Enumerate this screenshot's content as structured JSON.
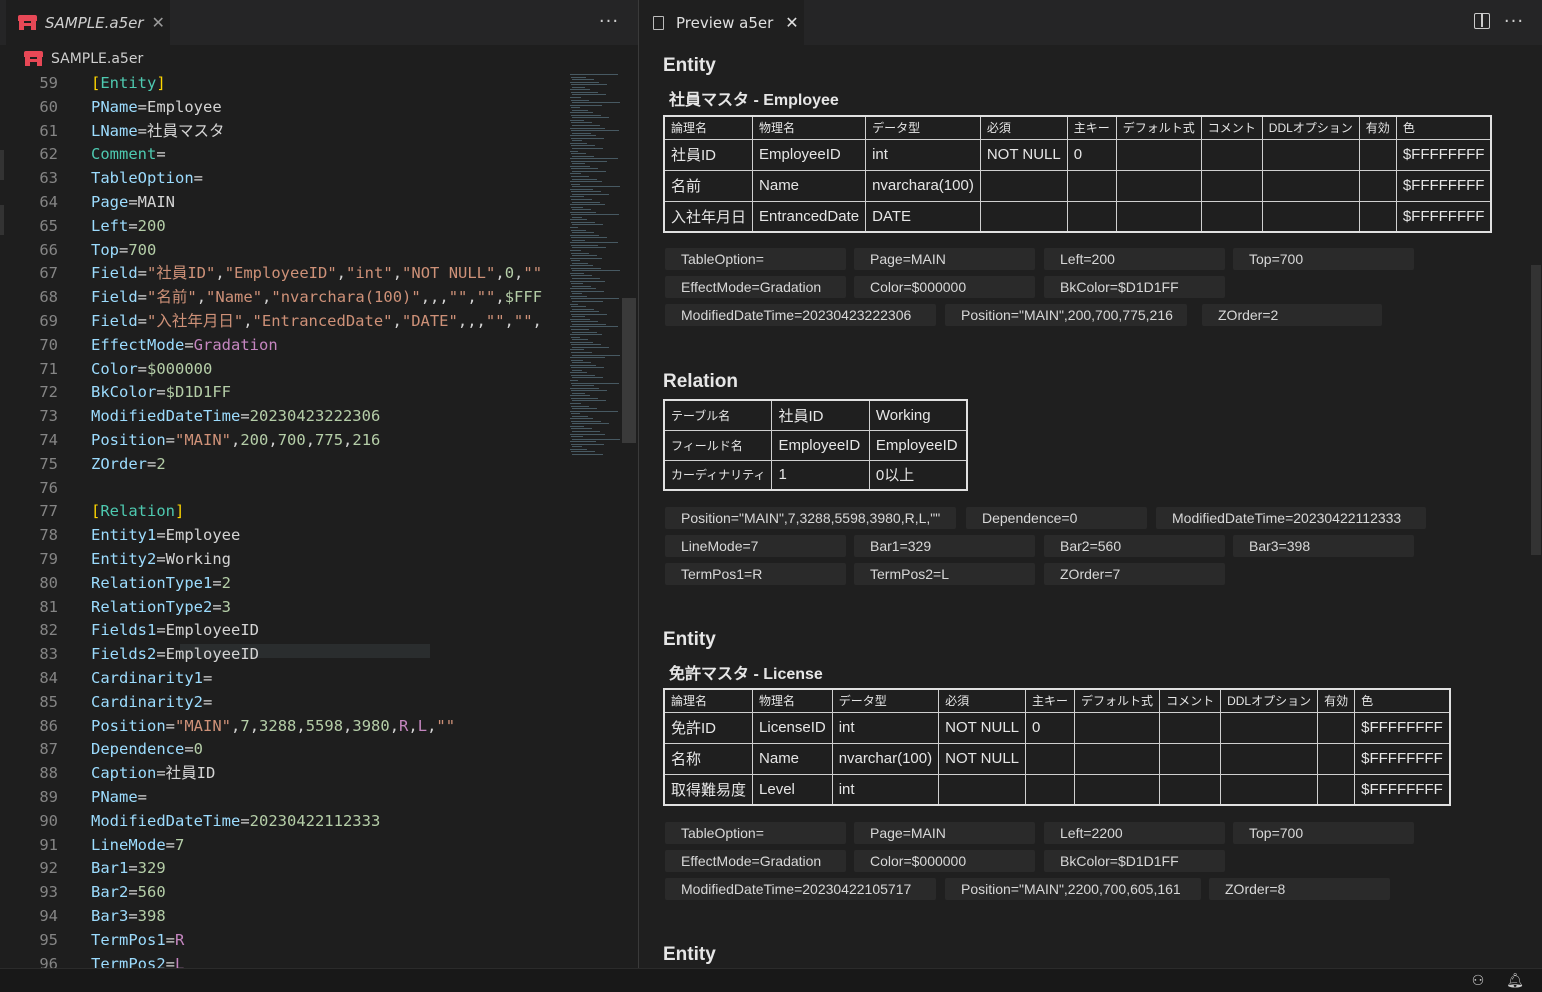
{
  "left_tab": {
    "title": "SAMPLE.a5er",
    "close": "✕"
  },
  "breadcrumb": {
    "file": "SAMPLE.a5er"
  },
  "more_glyph": "···",
  "right_tab": {
    "title": "Preview a5er",
    "close": "✕"
  },
  "code_lines": [
    {
      "n": "59",
      "segs": [
        [
          "br",
          "["
        ],
        [
          "sec",
          "Entity"
        ],
        [
          "br",
          "]"
        ]
      ]
    },
    {
      "n": "60",
      "segs": [
        [
          "k",
          "PName"
        ],
        [
          "op",
          "="
        ],
        [
          "v",
          "Employee"
        ]
      ]
    },
    {
      "n": "61",
      "segs": [
        [
          "k",
          "LName"
        ],
        [
          "op",
          "="
        ],
        [
          "v",
          "社員マスタ"
        ]
      ]
    },
    {
      "n": "62",
      "segs": [
        [
          "sec",
          "Comment"
        ],
        [
          "op",
          "="
        ]
      ]
    },
    {
      "n": "63",
      "segs": [
        [
          "k",
          "TableOption"
        ],
        [
          "op",
          "="
        ]
      ]
    },
    {
      "n": "64",
      "segs": [
        [
          "k",
          "Page"
        ],
        [
          "op",
          "="
        ],
        [
          "v",
          "MAIN"
        ]
      ]
    },
    {
      "n": "65",
      "segs": [
        [
          "k",
          "Left"
        ],
        [
          "op",
          "="
        ],
        [
          "n",
          "200"
        ]
      ]
    },
    {
      "n": "66",
      "segs": [
        [
          "k",
          "Top"
        ],
        [
          "op",
          "="
        ],
        [
          "n",
          "700"
        ]
      ]
    },
    {
      "n": "67",
      "segs": [
        [
          "k",
          "Field"
        ],
        [
          "op",
          "="
        ],
        [
          "s",
          "\"社員ID\""
        ],
        [
          "op",
          ","
        ],
        [
          "s",
          "\"EmployeeID\""
        ],
        [
          "op",
          ","
        ],
        [
          "s",
          "\"int\""
        ],
        [
          "op",
          ","
        ],
        [
          "s",
          "\"NOT NULL\""
        ],
        [
          "op",
          ","
        ],
        [
          "n",
          "0"
        ],
        [
          "op",
          ","
        ],
        [
          "s",
          "\"\""
        ]
      ]
    },
    {
      "n": "68",
      "segs": [
        [
          "k",
          "Field"
        ],
        [
          "op",
          "="
        ],
        [
          "s",
          "\"名前\""
        ],
        [
          "op",
          ","
        ],
        [
          "s",
          "\"Name\""
        ],
        [
          "op",
          ","
        ],
        [
          "s",
          "\"nvarchara(100)\""
        ],
        [
          "op",
          ",,,"
        ],
        [
          "s",
          "\"\""
        ],
        [
          "op",
          ","
        ],
        [
          "s",
          "\"\""
        ],
        [
          "op",
          ","
        ],
        [
          "n",
          "$FFF"
        ]
      ]
    },
    {
      "n": "69",
      "segs": [
        [
          "k",
          "Field"
        ],
        [
          "op",
          "="
        ],
        [
          "s",
          "\"入社年月日\""
        ],
        [
          "op",
          ","
        ],
        [
          "s",
          "\"EntrancedDate\""
        ],
        [
          "op",
          ","
        ],
        [
          "s",
          "\"DATE\""
        ],
        [
          "op",
          ",,,"
        ],
        [
          "s",
          "\"\""
        ],
        [
          "op",
          ","
        ],
        [
          "s",
          "\"\""
        ],
        [
          "op",
          ","
        ]
      ]
    },
    {
      "n": "70",
      "segs": [
        [
          "k",
          "EffectMode"
        ],
        [
          "op",
          "="
        ],
        [
          "m",
          "Gradation"
        ]
      ]
    },
    {
      "n": "71",
      "segs": [
        [
          "k",
          "Color"
        ],
        [
          "op",
          "="
        ],
        [
          "n",
          "$000000"
        ]
      ]
    },
    {
      "n": "72",
      "segs": [
        [
          "k",
          "BkColor"
        ],
        [
          "op",
          "="
        ],
        [
          "n",
          "$D1D1FF"
        ]
      ]
    },
    {
      "n": "73",
      "segs": [
        [
          "k",
          "ModifiedDateTime"
        ],
        [
          "op",
          "="
        ],
        [
          "n",
          "20230423222306"
        ]
      ]
    },
    {
      "n": "74",
      "segs": [
        [
          "k",
          "Position"
        ],
        [
          "op",
          "="
        ],
        [
          "s",
          "\"MAIN\""
        ],
        [
          "op",
          ","
        ],
        [
          "n",
          "200"
        ],
        [
          "op",
          ","
        ],
        [
          "n",
          "700"
        ],
        [
          "op",
          ","
        ],
        [
          "n",
          "775"
        ],
        [
          "op",
          ","
        ],
        [
          "n",
          "216"
        ]
      ]
    },
    {
      "n": "75",
      "segs": [
        [
          "k",
          "ZOrder"
        ],
        [
          "op",
          "="
        ],
        [
          "n",
          "2"
        ]
      ]
    },
    {
      "n": "76",
      "segs": []
    },
    {
      "n": "77",
      "segs": [
        [
          "br",
          "["
        ],
        [
          "sec",
          "Relation"
        ],
        [
          "br",
          "]"
        ]
      ]
    },
    {
      "n": "78",
      "segs": [
        [
          "k",
          "Entity1"
        ],
        [
          "op",
          "="
        ],
        [
          "v",
          "Employee"
        ]
      ]
    },
    {
      "n": "79",
      "segs": [
        [
          "k",
          "Entity2"
        ],
        [
          "op",
          "="
        ],
        [
          "v",
          "Working"
        ]
      ]
    },
    {
      "n": "80",
      "segs": [
        [
          "k",
          "RelationType1"
        ],
        [
          "op",
          "="
        ],
        [
          "n",
          "2"
        ]
      ]
    },
    {
      "n": "81",
      "segs": [
        [
          "k",
          "RelationType2"
        ],
        [
          "op",
          "="
        ],
        [
          "n",
          "3"
        ]
      ]
    },
    {
      "n": "82",
      "segs": [
        [
          "k",
          "Fields1"
        ],
        [
          "op",
          "="
        ],
        [
          "v",
          "EmployeeID"
        ]
      ]
    },
    {
      "n": "83",
      "segs": [
        [
          "k",
          "Fields2"
        ],
        [
          "op",
          "="
        ],
        [
          "v",
          "EmployeeID"
        ]
      ]
    },
    {
      "n": "84",
      "segs": [
        [
          "k",
          "Cardinarity1"
        ],
        [
          "op",
          "="
        ]
      ]
    },
    {
      "n": "85",
      "segs": [
        [
          "k",
          "Cardinarity2"
        ],
        [
          "op",
          "="
        ]
      ]
    },
    {
      "n": "86",
      "segs": [
        [
          "k",
          "Position"
        ],
        [
          "op",
          "="
        ],
        [
          "s",
          "\"MAIN\""
        ],
        [
          "op",
          ","
        ],
        [
          "n",
          "7"
        ],
        [
          "op",
          ","
        ],
        [
          "n",
          "3288"
        ],
        [
          "op",
          ","
        ],
        [
          "n",
          "5598"
        ],
        [
          "op",
          ","
        ],
        [
          "n",
          "3980"
        ],
        [
          "op",
          ","
        ],
        [
          "m",
          "R"
        ],
        [
          "op",
          ","
        ],
        [
          "m",
          "L"
        ],
        [
          "op",
          ","
        ],
        [
          "s",
          "\"\""
        ]
      ]
    },
    {
      "n": "87",
      "segs": [
        [
          "k",
          "Dependence"
        ],
        [
          "op",
          "="
        ],
        [
          "n",
          "0"
        ]
      ]
    },
    {
      "n": "88",
      "segs": [
        [
          "k",
          "Caption"
        ],
        [
          "op",
          "="
        ],
        [
          "v",
          "社員ID"
        ]
      ]
    },
    {
      "n": "89",
      "segs": [
        [
          "k",
          "PName"
        ],
        [
          "op",
          "="
        ]
      ]
    },
    {
      "n": "90",
      "segs": [
        [
          "k",
          "ModifiedDateTime"
        ],
        [
          "op",
          "="
        ],
        [
          "n",
          "20230422112333"
        ]
      ]
    },
    {
      "n": "91",
      "segs": [
        [
          "k",
          "LineMode"
        ],
        [
          "op",
          "="
        ],
        [
          "n",
          "7"
        ]
      ]
    },
    {
      "n": "92",
      "segs": [
        [
          "k",
          "Bar1"
        ],
        [
          "op",
          "="
        ],
        [
          "n",
          "329"
        ]
      ]
    },
    {
      "n": "93",
      "segs": [
        [
          "k",
          "Bar2"
        ],
        [
          "op",
          "="
        ],
        [
          "n",
          "560"
        ]
      ]
    },
    {
      "n": "94",
      "segs": [
        [
          "k",
          "Bar3"
        ],
        [
          "op",
          "="
        ],
        [
          "n",
          "398"
        ]
      ]
    },
    {
      "n": "95",
      "segs": [
        [
          "k",
          "TermPos1"
        ],
        [
          "op",
          "="
        ],
        [
          "m",
          "R"
        ]
      ]
    },
    {
      "n": "96",
      "segs": [
        [
          "k",
          "TermPos2"
        ],
        [
          "op",
          "="
        ],
        [
          "m",
          "L"
        ]
      ]
    }
  ],
  "preview": {
    "entity1": {
      "section": "Entity",
      "title": "社員マスタ - Employee",
      "headers": [
        "論理名",
        "物理名",
        "データ型",
        "必須",
        "主キー",
        "デフォルト式",
        "コメント",
        "DDLオプション",
        "有効",
        "色"
      ],
      "rows": [
        [
          "社員ID",
          "EmployeeID",
          "int",
          "NOT NULL",
          "0",
          "",
          "",
          "",
          "",
          "$FFFFFFFF"
        ],
        [
          "名前",
          "Name",
          "nvarchara(100)",
          "",
          "",
          "",
          "",
          "",
          "",
          "$FFFFFFFF"
        ],
        [
          "入社年月日",
          "EntrancedDate",
          "DATE",
          "",
          "",
          "",
          "",
          "",
          "",
          "$FFFFFFFF"
        ]
      ],
      "chips": [
        "TableOption=",
        "Page=MAIN",
        "Left=200",
        "Top=700",
        "EffectMode=Gradation",
        "Color=$000000",
        "BkColor=$D1D1FF",
        "ModifiedDateTime=20230423222306",
        "Position=\"MAIN\",200,700,775,216",
        "ZOrder=2"
      ]
    },
    "relation": {
      "section": "Relation",
      "rows": [
        [
          "テーブル名",
          "社員ID",
          "Working"
        ],
        [
          "フィールド名",
          "EmployeeID",
          "EmployeeID"
        ],
        [
          "カーディナリティ",
          "1",
          "0以上"
        ]
      ],
      "chips": [
        "Position=\"MAIN\",7,3288,5598,3980,R,L,\"\"",
        "Dependence=0",
        "ModifiedDateTime=20230422112333",
        "LineMode=7",
        "Bar1=329",
        "Bar2=560",
        "Bar3=398",
        "TermPos1=R",
        "TermPos2=L",
        "ZOrder=7"
      ]
    },
    "entity2": {
      "section": "Entity",
      "title": "免許マスタ - License",
      "headers": [
        "論理名",
        "物理名",
        "データ型",
        "必須",
        "主キー",
        "デフォルト式",
        "コメント",
        "DDLオプション",
        "有効",
        "色"
      ],
      "rows": [
        [
          "免許ID",
          "LicenseID",
          "int",
          "NOT NULL",
          "0",
          "",
          "",
          "",
          "",
          "$FFFFFFFF"
        ],
        [
          "名称",
          "Name",
          "nvarchar(100)",
          "NOT NULL",
          "",
          "",
          "",
          "",
          "",
          "$FFFFFFFF"
        ],
        [
          "取得難易度",
          "Level",
          "int",
          "",
          "",
          "",
          "",
          "",
          "",
          "$FFFFFFFF"
        ]
      ],
      "chips": [
        "TableOption=",
        "Page=MAIN",
        "Left=2200",
        "Top=700",
        "EffectMode=Gradation",
        "Color=$000000",
        "BkColor=$D1D1FF",
        "ModifiedDateTime=20230422105717",
        "Position=\"MAIN\",2200,700,605,161",
        "ZOrder=8"
      ]
    },
    "entity3": {
      "section": "Entity"
    }
  },
  "status": {
    "accounts_icon": "⚇",
    "bell_icon": "🔔︎"
  }
}
